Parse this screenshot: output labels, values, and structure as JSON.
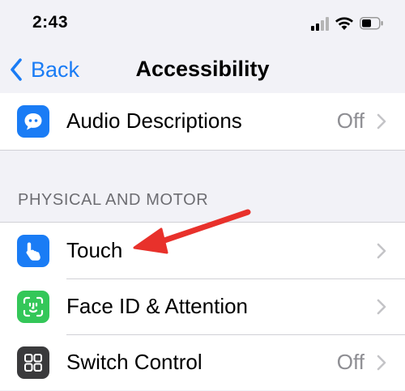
{
  "status_bar": {
    "time": "2:43",
    "icons": [
      "cellular-signal-icon",
      "wifi-icon",
      "battery-icon"
    ]
  },
  "nav": {
    "back_label": "Back",
    "title": "Accessibility"
  },
  "rows_top": [
    {
      "label": "Audio Descriptions",
      "value": "Off",
      "icon": "speech-bubble-icon",
      "icon_color": "#1a7cf5"
    }
  ],
  "section_header": "PHYSICAL AND MOTOR",
  "rows": [
    {
      "label": "Touch",
      "value": "",
      "icon": "hand-pointing-icon",
      "icon_color": "#1a7cf5"
    },
    {
      "label": "Face ID & Attention",
      "value": "",
      "icon": "face-id-icon",
      "icon_color": "#34c759"
    },
    {
      "label": "Switch Control",
      "value": "Off",
      "icon": "grid-squares-icon",
      "icon_color": "#3a3a3c"
    }
  ],
  "colors": {
    "accent": "#1a7cf5",
    "annotation_arrow": "#e8312b",
    "background": "#f2f2f7"
  }
}
